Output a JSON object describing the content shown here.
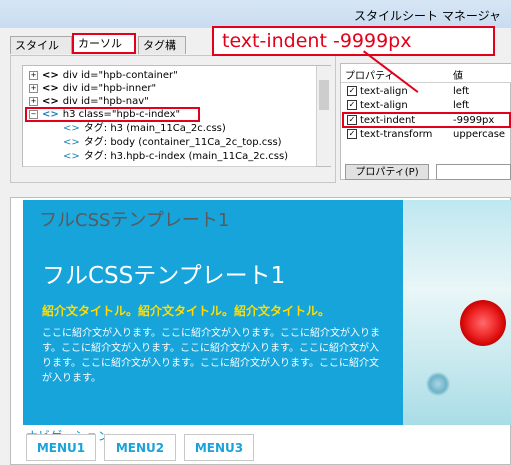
{
  "window": {
    "title": "スタイルシート マネージャ"
  },
  "tabs": [
    {
      "label": "スタイル構成"
    },
    {
      "label": "カーソル位置"
    },
    {
      "label": "タグ構造"
    }
  ],
  "tree": {
    "nodes": [
      {
        "label": "div id=\"hpb-container\""
      },
      {
        "label": "div id=\"hpb-inner\""
      },
      {
        "label": "div id=\"hpb-nav\""
      },
      {
        "label": "h3 class=\"hpb-c-index\""
      },
      {
        "label": "タグ: h3 (main_11Ca_2c.css)"
      },
      {
        "label": "タグ: body (container_11Ca_2c_top.css)"
      },
      {
        "label": "タグ: h3.hpb-c-index (main_11Ca_2c.css)"
      }
    ]
  },
  "properties": {
    "col_property": "プロパティ",
    "col_value": "値",
    "rows": [
      {
        "name": "text-align",
        "value": "left"
      },
      {
        "name": "text-align",
        "value": "left"
      },
      {
        "name": "text-indent",
        "value": "-9999px"
      },
      {
        "name": "text-transform",
        "value": "uppercase"
      }
    ],
    "button_label": "プロパティ(P)"
  },
  "callout": {
    "text": "text-indent   -9999px"
  },
  "preview": {
    "title_plain": "フルCSSテンプレート1",
    "title_main": "フルCSSテンプレート1",
    "subtitle": "紹介文タイトル。紹介文タイトル。紹介文タイトル。",
    "paragraph": "ここに紹介文が入ります。ここに紹介文が入ります。ここに紹介文が入ります。ここに紹介文が入ります。ここに紹介文が入ります。ここに紹介文が入ります。ここに紹介文が入ります。ここに紹介文が入ります。ここに紹介文が入ります。",
    "nav_label": "ナビゲーション",
    "menus": [
      "MENU1",
      "MENU2",
      "MENU3"
    ]
  },
  "colors": {
    "accent": "#e3001b",
    "hero": "#16a4db",
    "subtitle": "#ffdd00",
    "menu": "#1ba3d9"
  }
}
